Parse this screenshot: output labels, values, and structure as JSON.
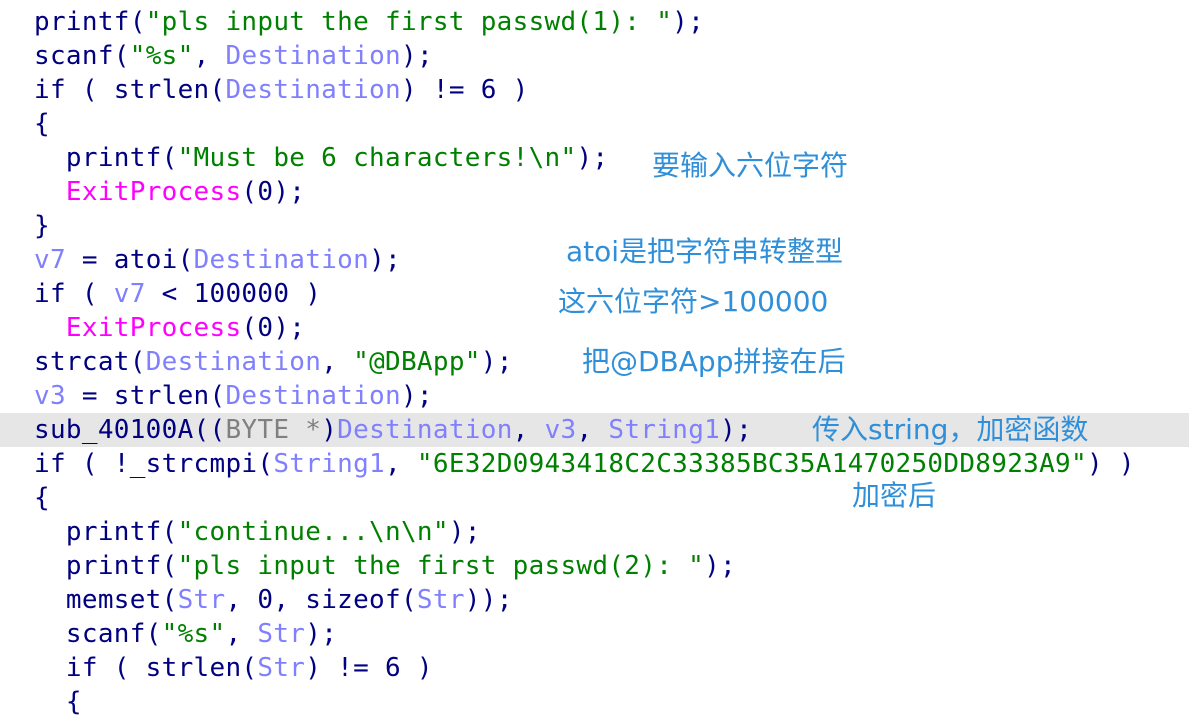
{
  "colors": {
    "plain": "#000080",
    "string": "#008000",
    "variable": "#8080ff",
    "exit_call": "#ff00ff",
    "type": "#808080",
    "annotation": "#2f8fd8",
    "highlight_line": "#e6e6e6"
  },
  "code_lines": [
    {
      "highlight": false,
      "tokens": [
        {
          "k": "plain",
          "t": "printf("
        },
        {
          "k": "str",
          "t": "\"pls input the first passwd(1): \""
        },
        {
          "k": "plain",
          "t": ");"
        }
      ]
    },
    {
      "highlight": false,
      "tokens": [
        {
          "k": "plain",
          "t": "scanf("
        },
        {
          "k": "str",
          "t": "\"%s\""
        },
        {
          "k": "plain",
          "t": ", "
        },
        {
          "k": "var",
          "t": "Destination"
        },
        {
          "k": "plain",
          "t": ");"
        }
      ]
    },
    {
      "highlight": false,
      "tokens": [
        {
          "k": "plain",
          "t": "if ( strlen("
        },
        {
          "k": "var",
          "t": "Destination"
        },
        {
          "k": "plain",
          "t": ") != 6 )"
        }
      ]
    },
    {
      "highlight": false,
      "tokens": [
        {
          "k": "plain",
          "t": "{"
        }
      ]
    },
    {
      "highlight": false,
      "tokens": [
        {
          "k": "plain",
          "t": "  printf("
        },
        {
          "k": "str",
          "t": "\"Must be 6 characters!\\n\""
        },
        {
          "k": "plain",
          "t": ");"
        }
      ]
    },
    {
      "highlight": false,
      "tokens": [
        {
          "k": "plain",
          "t": "  "
        },
        {
          "k": "exit",
          "t": "ExitProcess"
        },
        {
          "k": "plain",
          "t": "(0);"
        }
      ]
    },
    {
      "highlight": false,
      "tokens": [
        {
          "k": "plain",
          "t": "}"
        }
      ]
    },
    {
      "highlight": false,
      "tokens": [
        {
          "k": "var",
          "t": "v7"
        },
        {
          "k": "plain",
          "t": " = atoi("
        },
        {
          "k": "var",
          "t": "Destination"
        },
        {
          "k": "plain",
          "t": ");"
        }
      ]
    },
    {
      "highlight": false,
      "tokens": [
        {
          "k": "plain",
          "t": "if ( "
        },
        {
          "k": "var",
          "t": "v7"
        },
        {
          "k": "plain",
          "t": " < 100000 )"
        }
      ]
    },
    {
      "highlight": false,
      "tokens": [
        {
          "k": "plain",
          "t": "  "
        },
        {
          "k": "exit",
          "t": "ExitProcess"
        },
        {
          "k": "plain",
          "t": "(0);"
        }
      ]
    },
    {
      "highlight": false,
      "tokens": [
        {
          "k": "plain",
          "t": "strcat("
        },
        {
          "k": "var",
          "t": "Destination"
        },
        {
          "k": "plain",
          "t": ", "
        },
        {
          "k": "str",
          "t": "\"@DBApp\""
        },
        {
          "k": "plain",
          "t": ");"
        }
      ]
    },
    {
      "highlight": false,
      "tokens": [
        {
          "k": "var",
          "t": "v3"
        },
        {
          "k": "plain",
          "t": " = strlen("
        },
        {
          "k": "var",
          "t": "Destination"
        },
        {
          "k": "plain",
          "t": ");"
        }
      ]
    },
    {
      "highlight": true,
      "tokens": [
        {
          "k": "plain",
          "t": "sub_40100A(("
        },
        {
          "k": "type",
          "t": "BYTE *"
        },
        {
          "k": "plain",
          "t": ")"
        },
        {
          "k": "var",
          "t": "Destination"
        },
        {
          "k": "plain",
          "t": ", "
        },
        {
          "k": "var",
          "t": "v3"
        },
        {
          "k": "plain",
          "t": ", "
        },
        {
          "k": "var",
          "t": "String1"
        },
        {
          "k": "plain",
          "t": ");"
        }
      ]
    },
    {
      "highlight": false,
      "tokens": [
        {
          "k": "plain",
          "t": "if ( !_strcmpi("
        },
        {
          "k": "var",
          "t": "String1"
        },
        {
          "k": "plain",
          "t": ", "
        },
        {
          "k": "str",
          "t": "\"6E32D0943418C2C33385BC35A1470250DD8923A9\""
        },
        {
          "k": "plain",
          "t": ") )"
        }
      ]
    },
    {
      "highlight": false,
      "tokens": [
        {
          "k": "plain",
          "t": "{"
        }
      ]
    },
    {
      "highlight": false,
      "tokens": [
        {
          "k": "plain",
          "t": "  printf("
        },
        {
          "k": "str",
          "t": "\"continue...\\n\\n\""
        },
        {
          "k": "plain",
          "t": ");"
        }
      ]
    },
    {
      "highlight": false,
      "tokens": [
        {
          "k": "plain",
          "t": "  printf("
        },
        {
          "k": "str",
          "t": "\"pls input the first passwd(2): \""
        },
        {
          "k": "plain",
          "t": ");"
        }
      ]
    },
    {
      "highlight": false,
      "tokens": [
        {
          "k": "plain",
          "t": "  memset("
        },
        {
          "k": "var",
          "t": "Str"
        },
        {
          "k": "plain",
          "t": ", 0, sizeof("
        },
        {
          "k": "var",
          "t": "Str"
        },
        {
          "k": "plain",
          "t": "));"
        }
      ]
    },
    {
      "highlight": false,
      "tokens": [
        {
          "k": "plain",
          "t": "  scanf("
        },
        {
          "k": "str",
          "t": "\"%s\""
        },
        {
          "k": "plain",
          "t": ", "
        },
        {
          "k": "var",
          "t": "Str"
        },
        {
          "k": "plain",
          "t": ");"
        }
      ]
    },
    {
      "highlight": false,
      "tokens": [
        {
          "k": "plain",
          "t": "  if ( strlen("
        },
        {
          "k": "var",
          "t": "Str"
        },
        {
          "k": "plain",
          "t": ") != 6 )"
        }
      ]
    },
    {
      "highlight": false,
      "tokens": [
        {
          "k": "plain",
          "t": "  {"
        }
      ]
    }
  ],
  "annotations": {
    "six_chars": "要输入六位字符",
    "atoi_note": "atoi是把字符串转整型",
    "gt_note": "这六位字符>100000",
    "concat_note": "把@DBApp拼接在后",
    "encrypt_note": "传入string，加密函数",
    "after_encrypt": "加密后"
  }
}
